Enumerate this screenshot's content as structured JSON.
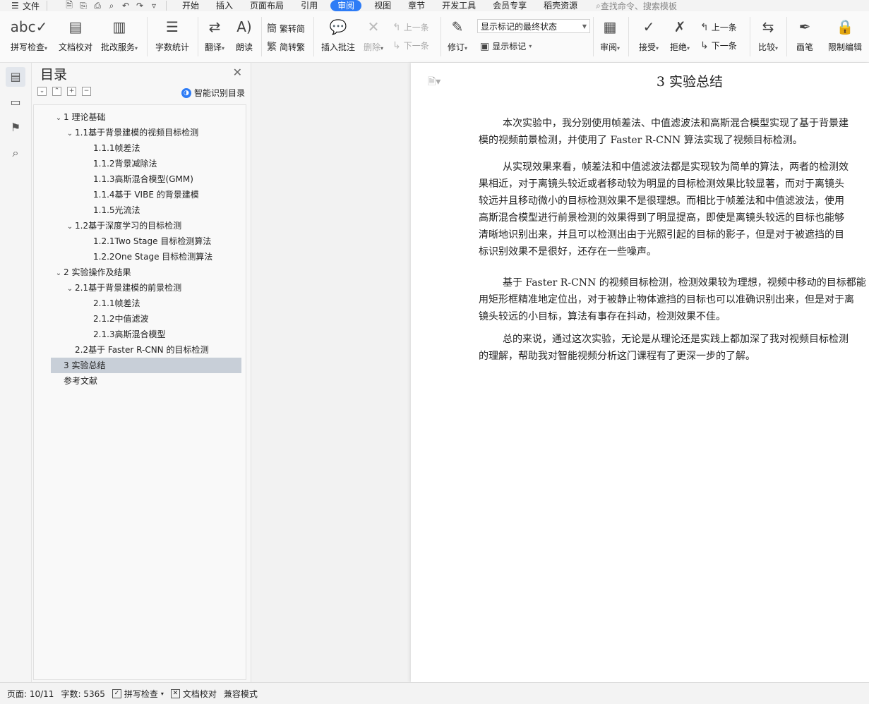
{
  "menubar": {
    "file_label": "文件",
    "tabs": [
      {
        "label": "开始"
      },
      {
        "label": "插入"
      },
      {
        "label": "页面布局"
      },
      {
        "label": "引用"
      },
      {
        "label": "审阅"
      },
      {
        "label": "视图"
      },
      {
        "label": "章节"
      },
      {
        "label": "开发工具"
      },
      {
        "label": "会员专享"
      },
      {
        "label": "稻壳资源"
      }
    ],
    "active_tab": "审阅",
    "search_placeholder": "查找命令、搜索模板"
  },
  "ribbon": {
    "spell_check": "拼写检查",
    "doc_proof": "文档校对",
    "batch_service": "批改服务",
    "word_count": "字数统计",
    "translate": "翻译",
    "read_aloud": "朗读",
    "trad_to_simp": "繁转简",
    "simp_to_trad": "简转繁",
    "insert_comment": "插入批注",
    "delete": "删除",
    "prev_comment": "上一条",
    "next_comment": "下一条",
    "track_changes": "修订",
    "markup_state": "显示标记的最终状态",
    "show_markup": "显示标记",
    "review": "审阅",
    "accept": "接受",
    "reject": "拒绝",
    "prev_change": "上一条",
    "next_change": "下一条",
    "compare": "比较",
    "pen": "画笔",
    "restrict_edit": "限制编辑"
  },
  "toc": {
    "title": "目录",
    "smart_button": "智能识别目录",
    "items": [
      {
        "label": "1 理论基础",
        "level": 0,
        "expanded": true
      },
      {
        "label": "1.1基于背景建模的视频目标检测",
        "level": 1,
        "expanded": true
      },
      {
        "label": "1.1.1帧差法",
        "level": 2
      },
      {
        "label": "1.1.2背景减除法",
        "level": 2
      },
      {
        "label": "1.1.3高斯混合模型(GMM)",
        "level": 2
      },
      {
        "label": "1.1.4基于 VIBE 的背景建模",
        "level": 2
      },
      {
        "label": "1.1.5光流法",
        "level": 2
      },
      {
        "label": "1.2基于深度学习的目标检测",
        "level": 1,
        "expanded": true
      },
      {
        "label": "1.2.1Two Stage 目标检测算法",
        "level": 2
      },
      {
        "label": "1.2.2One Stage 目标检测算法",
        "level": 2
      },
      {
        "label": "2 实验操作及结果",
        "level": 0,
        "expanded": true
      },
      {
        "label": "2.1基于背景建模的前景检测",
        "level": 1,
        "expanded": true
      },
      {
        "label": "2.1.1帧差法",
        "level": 2
      },
      {
        "label": "2.1.2中值滤波",
        "level": 2
      },
      {
        "label": "2.1.3高斯混合模型",
        "level": 2
      },
      {
        "label": "2.2基于 Faster R-CNN 的目标检测",
        "level": 1
      },
      {
        "label": "3 实验总结",
        "level": 0,
        "selected": true
      },
      {
        "label": "参考文献",
        "level": 0
      }
    ]
  },
  "document": {
    "heading": "3 实验总结",
    "paragraphs": [
      [
        "本次实验中，我分别使用帧差法、中值滤波法和高斯混合模型实现了基于背景建",
        "模的视频前景检测，并使用了 Faster R-CNN 算法实现了视频目标检测。"
      ],
      [
        "从实现效果来看，帧差法和中值滤波法都是实现较为简单的算法，两者的检测效",
        "果相近，对于离镜头较近或者移动较为明显的目标检测效果比较显著，而对于离镜头",
        "较远并且移动微小的目标检测效果不是很理想。而相比于帧差法和中值滤波法，使用",
        "高斯混合模型进行前景检测的效果得到了明显提高，即使是离镜头较远的目标也能够",
        "清晰地识别出来，并且可以检测出由于光照引起的目标的影子，但是对于被遮挡的目",
        "标识别效果不是很好，还存在一些噪声。"
      ],
      [
        "基于 Faster R-CNN 的视频目标检测，检测效果较为理想，视频中移动的目标都能",
        "用矩形框精准地定位出，对于被静止物体遮挡的目标也可以准确识别出来，但是对于离",
        "镜头较远的小目标，算法有事存在抖动，检测效果不佳。"
      ],
      [
        "总的来说，通过这次实验，无论是从理论还是实践上都加深了我对视频目标检测",
        "的理解，帮助我对智能视频分析这门课程有了更深一步的了解。"
      ]
    ]
  },
  "status": {
    "page": "页面: 10/11",
    "word_count": "字数: 5365",
    "spell_check": "拼写检查",
    "doc_proof": "文档校对",
    "compat_mode": "兼容模式"
  }
}
